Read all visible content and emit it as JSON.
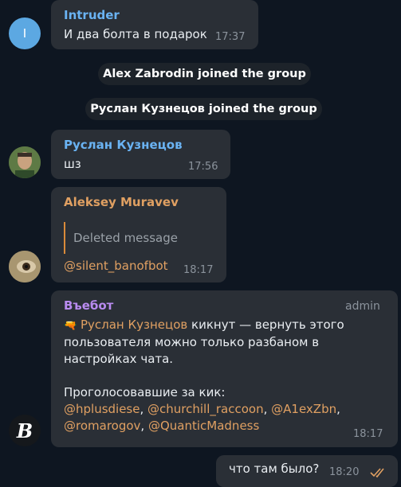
{
  "messages": {
    "m1": {
      "avatar_letter": "I",
      "sender": "Intruder",
      "text": "И два болта в подарок",
      "time": "17:37"
    },
    "service1": "Alex Zabrodin joined the group",
    "service2": "Руслан Кузнецов joined the group",
    "m2": {
      "sender": "Руслан Кузнецов",
      "text": "шз",
      "time": "17:56"
    },
    "m3": {
      "sender": "Aleksey Muravev",
      "quote": "Deleted message",
      "mention": "@silent_banofbot",
      "time": "18:17"
    },
    "m4": {
      "sender": "Въебот",
      "role": "admin",
      "emoji": "🔫",
      "kicked_user": "Руслан Кузнецов",
      "line1_rest": " кикнут — вернуть этого",
      "line2": "пользователя можно только разбаном в",
      "line3": "настройках чата.",
      "voters_label": "Проголосовавшие за кик:",
      "voters": [
        "@hplusdiese",
        "@churchill_raccoon",
        "@A1exZbn",
        "@romarogov",
        "@QuanticMadness"
      ],
      "time": "18:17"
    },
    "m5": {
      "text": "что там было?",
      "time": "18:20"
    }
  },
  "colors": {
    "background": "#0e1621",
    "bubble": "#2a2f36",
    "intruder": "#6ab3f3",
    "ruslan": "#6ab3f3",
    "aleksey": "#e0a062",
    "bot": "#b98bf0",
    "link": "#e0a062"
  }
}
